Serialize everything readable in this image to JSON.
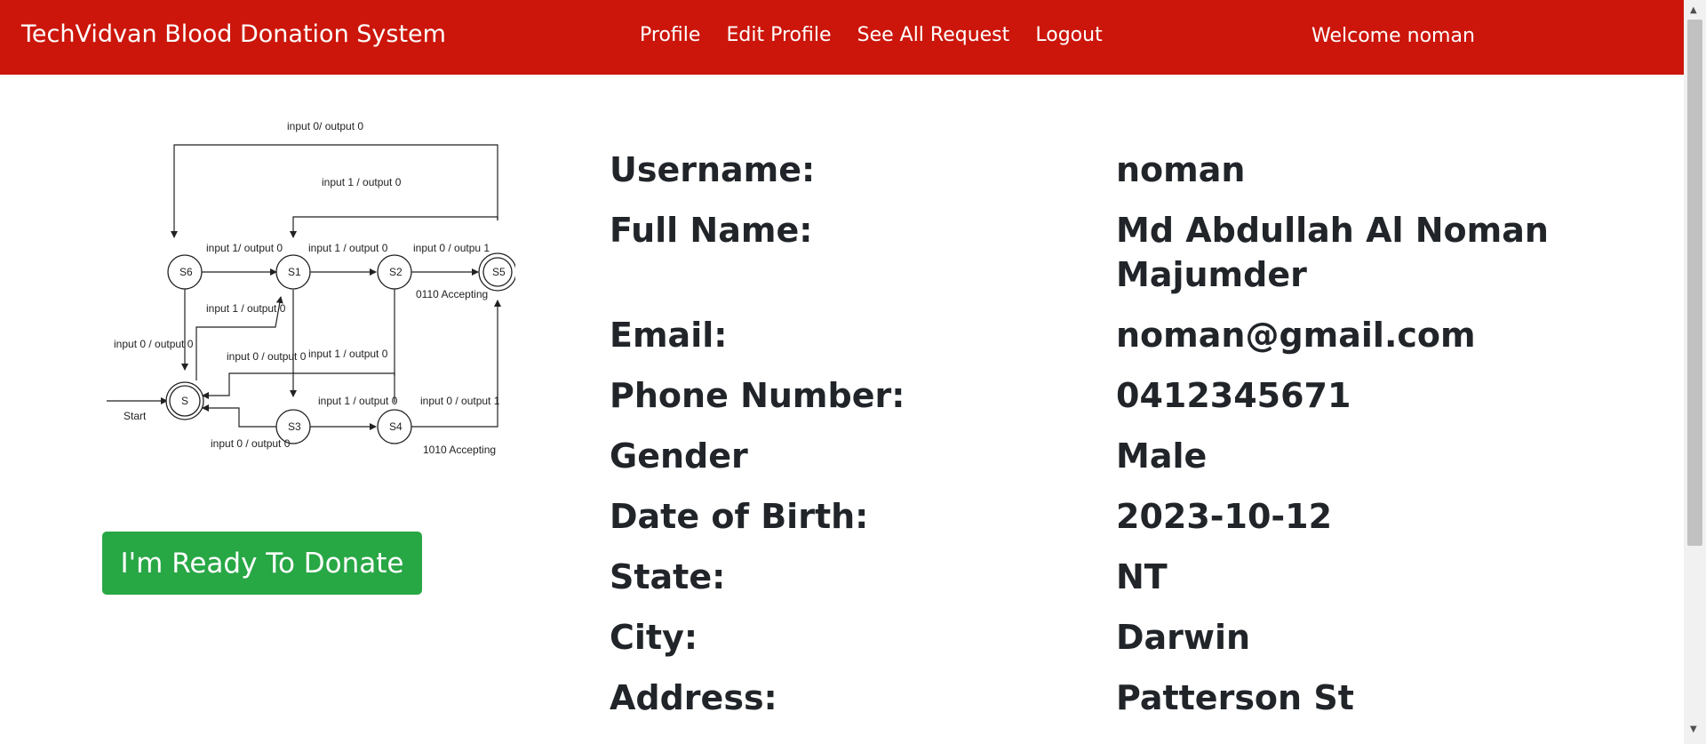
{
  "navbar": {
    "brand": "TechVidvan Blood Donation System",
    "links": [
      "Profile",
      "Edit Profile",
      "See All Request",
      "Logout"
    ],
    "welcome": "Welcome noman"
  },
  "image": {
    "states": [
      "S",
      "S1",
      "S2",
      "S3",
      "S4",
      "S5",
      "S6"
    ],
    "labels": {
      "top_loop": "input 0/ output 0",
      "loop_s5_s1": "input 1 / output 0",
      "s6_s1": "input 1/ output 0",
      "s1_s2": "input 1 / output 0",
      "s2_s5": "input 0 / outpu 1",
      "s2_note": "0110 Accepting",
      "s_s1": "input 1 / output 0",
      "s6_s": "input 0 / output 0",
      "s4_s_a": "input 0 / output 0",
      "s4_s_b": "input 1 / output 0",
      "s3_s4": "input 1 / output 0",
      "s4_s5": "input 0 / output 1",
      "s3_s": "input 0 / output 0",
      "s4_note": "1010 Accepting",
      "start": "Start"
    }
  },
  "donate_button": "I'm Ready To Donate",
  "profile": [
    {
      "label": "Username:",
      "value": "noman"
    },
    {
      "label": "Full Name:",
      "value": "Md Abdullah Al Noman Majumder"
    },
    {
      "label": "Email:",
      "value": "noman@gmail.com"
    },
    {
      "label": "Phone Number:",
      "value": "0412345671"
    },
    {
      "label": "Gender",
      "value": "Male"
    },
    {
      "label": "Date of Birth:",
      "value": "2023-10-12"
    },
    {
      "label": "State:",
      "value": "NT"
    },
    {
      "label": "City:",
      "value": "Darwin"
    },
    {
      "label": "Address:",
      "value": "Patterson St"
    }
  ],
  "colors": {
    "navbar": "#cc160b",
    "donate_button": "#28a745",
    "text": "#212529"
  }
}
